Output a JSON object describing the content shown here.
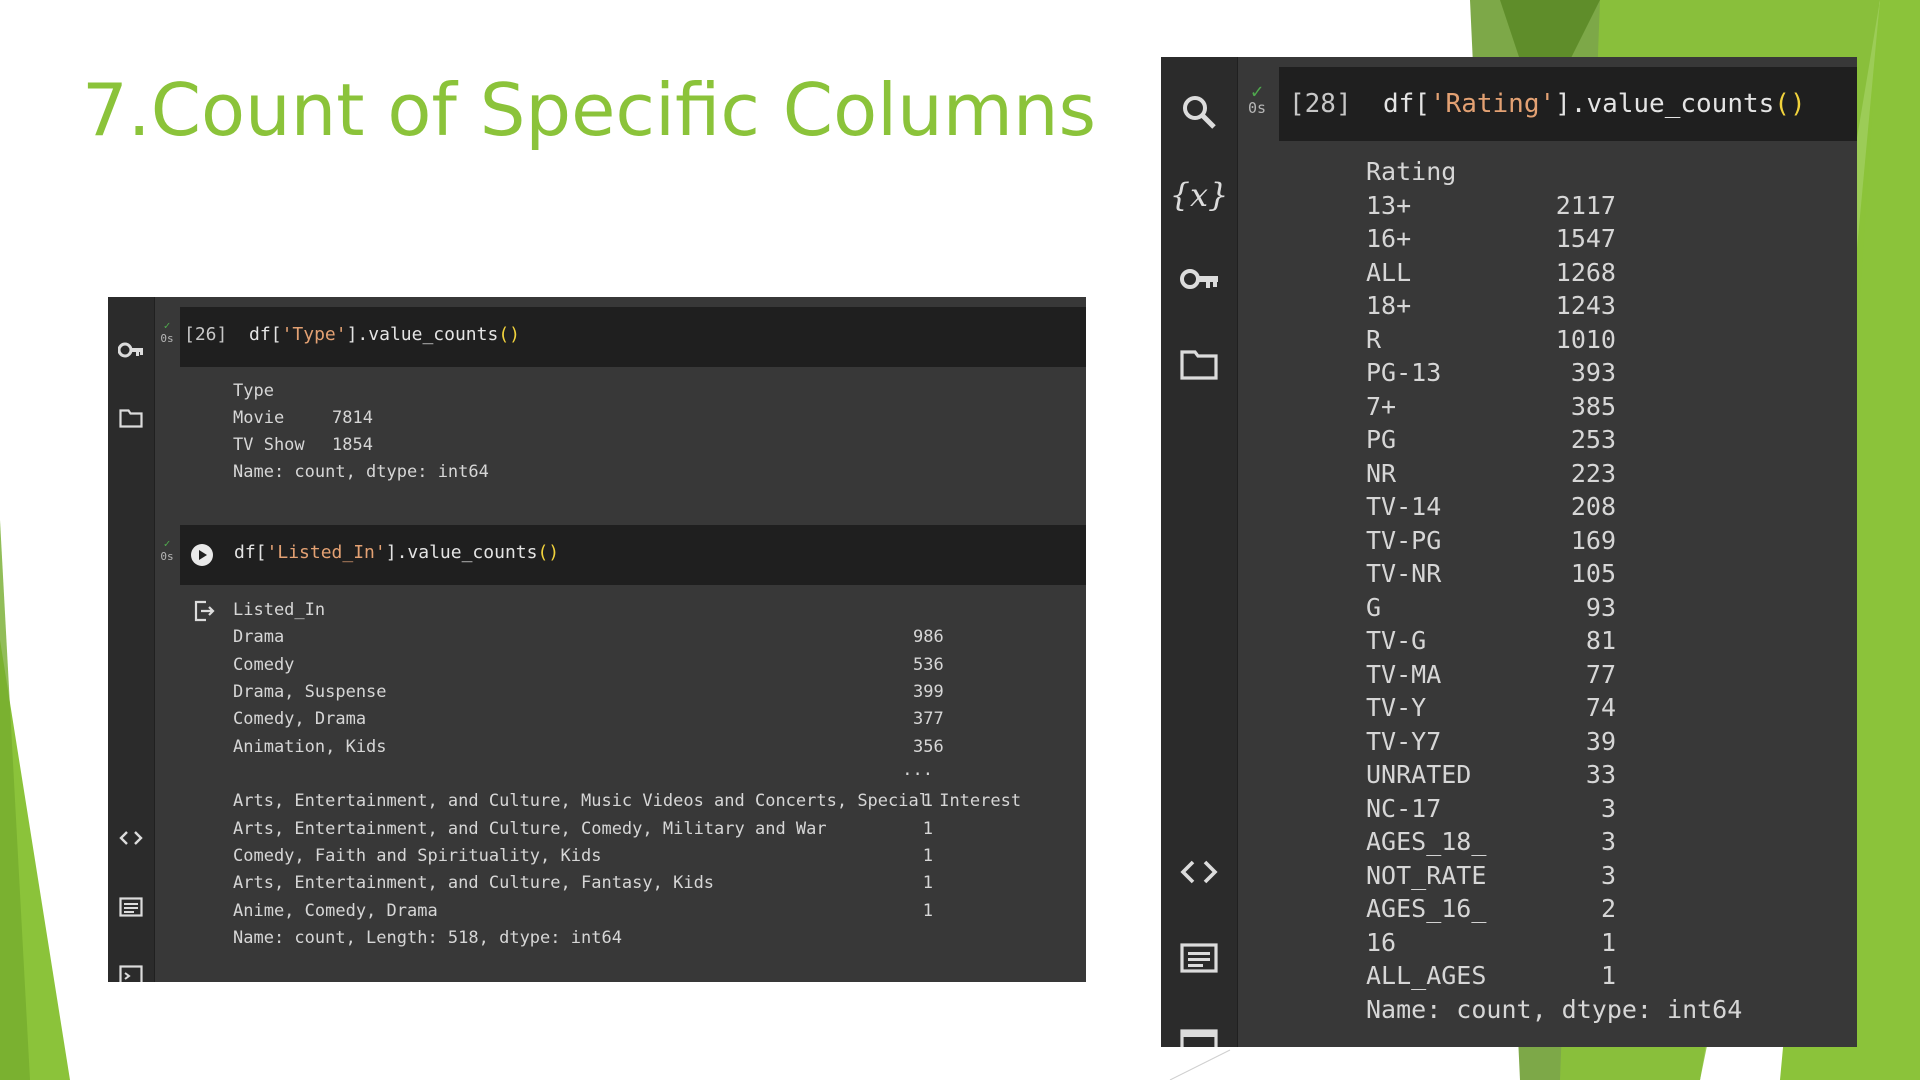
{
  "slide": {
    "title": "7.Count of Specific Columns"
  },
  "colors": {
    "accent_green": "#8bc33a",
    "panel_bg": "#383838",
    "sidebar_bg": "#2b2b2b",
    "cell_header_bg": "#1f1f1f",
    "check_green": "#4fa94d"
  },
  "left_screenshot": {
    "sidebar_icons": [
      "key-icon",
      "folder-icon",
      "code-icon",
      "list-icon",
      "terminal-icon"
    ],
    "cell1": {
      "status": "0s",
      "prompt": "[26]",
      "code_prefix": "df[",
      "code_string": "'Type'",
      "code_method": "].value_counts",
      "code_parens": "()",
      "output": {
        "header": "Type",
        "rows": [
          {
            "label": "Movie",
            "value": "7814"
          },
          {
            "label": "TV Show",
            "value": "1854"
          }
        ],
        "footer": "Name: count, dtype: int64"
      }
    },
    "cell2": {
      "status": "0s",
      "code_prefix": "df[",
      "code_string": "'Listed_In'",
      "code_method": "].value_counts",
      "code_parens": "()",
      "output": {
        "header": "Listed_In",
        "rows_top": [
          {
            "label": "Drama",
            "value": "986"
          },
          {
            "label": "Comedy",
            "value": "536"
          },
          {
            "label": "Drama, Suspense",
            "value": "399"
          },
          {
            "label": "Comedy, Drama",
            "value": "377"
          },
          {
            "label": "Animation, Kids",
            "value": "356"
          }
        ],
        "ellipsis": "...",
        "rows_bottom": [
          {
            "label": "Arts, Entertainment, and Culture, Music Videos and Concerts, Special Interest",
            "value": "1"
          },
          {
            "label": "Arts, Entertainment, and Culture, Comedy, Military and War",
            "value": "1"
          },
          {
            "label": "Comedy, Faith and Spirituality, Kids",
            "value": "1"
          },
          {
            "label": "Arts, Entertainment, and Culture, Fantasy, Kids",
            "value": "1"
          },
          {
            "label": "Anime, Comedy, Drama",
            "value": "1"
          }
        ],
        "footer": "Name: count, Length: 518, dtype: int64"
      }
    }
  },
  "right_screenshot": {
    "sidebar_icons": [
      "search-icon",
      "variables-icon",
      "key-icon",
      "folder-icon",
      "code-icon",
      "list-icon",
      "terminal-icon"
    ],
    "cell": {
      "status": "0s",
      "prompt": "[28]",
      "code_prefix": "df[",
      "code_string": "'Rating'",
      "code_method": "].value_counts",
      "code_parens": "()",
      "output": {
        "header": "Rating",
        "rows": [
          {
            "label": "13+",
            "value": "2117"
          },
          {
            "label": "16+",
            "value": "1547"
          },
          {
            "label": "ALL",
            "value": "1268"
          },
          {
            "label": "18+",
            "value": "1243"
          },
          {
            "label": "R",
            "value": "1010"
          },
          {
            "label": "PG-13",
            "value": "393"
          },
          {
            "label": "7+",
            "value": "385"
          },
          {
            "label": "PG",
            "value": "253"
          },
          {
            "label": "NR",
            "value": "223"
          },
          {
            "label": "TV-14",
            "value": "208"
          },
          {
            "label": "TV-PG",
            "value": "169"
          },
          {
            "label": "TV-NR",
            "value": "105"
          },
          {
            "label": "G",
            "value": "93"
          },
          {
            "label": "TV-G",
            "value": "81"
          },
          {
            "label": "TV-MA",
            "value": "77"
          },
          {
            "label": "TV-Y",
            "value": "74"
          },
          {
            "label": "TV-Y7",
            "value": "39"
          },
          {
            "label": "UNRATED",
            "value": "33"
          },
          {
            "label": "NC-17",
            "value": "3"
          },
          {
            "label": "AGES_18_",
            "value": "3"
          },
          {
            "label": "NOT_RATE",
            "value": "3"
          },
          {
            "label": "AGES_16_",
            "value": "2"
          },
          {
            "label": "16",
            "value": "1"
          },
          {
            "label": "ALL_AGES",
            "value": "1"
          }
        ],
        "footer": "Name: count, dtype: int64"
      }
    }
  }
}
